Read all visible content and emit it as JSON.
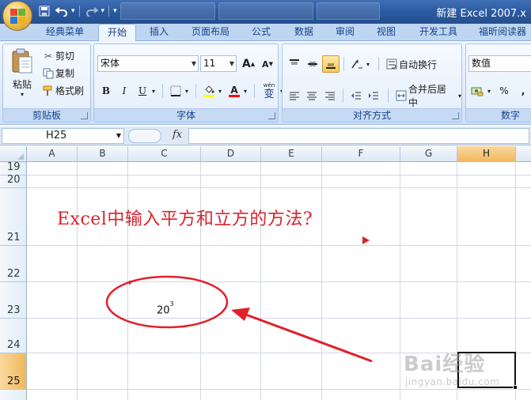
{
  "window": {
    "title": "新建 Excel 2007.x"
  },
  "quick_access": {
    "save_icon": "save-icon",
    "undo_icon": "undo-icon",
    "redo_icon": "redo-icon"
  },
  "ribbon_tabs": [
    "经典菜单",
    "开始",
    "插入",
    "页面布局",
    "公式",
    "数据",
    "审阅",
    "视图",
    "开发工具",
    "福昕阅读器"
  ],
  "active_tab": "开始",
  "clipboard": {
    "label": "剪贴板",
    "paste": "粘贴",
    "cut": "剪切",
    "copy": "复制",
    "format_painter": "格式刷"
  },
  "font": {
    "label": "字体",
    "name": "宋体",
    "size": "11",
    "grow_glyph": "A",
    "shrink_glyph": "A",
    "bold": "B",
    "italic": "I",
    "underline": "U",
    "font_color_glyph": "A",
    "phonetic_glyph": "wén",
    "phonetic_char": "变"
  },
  "alignment": {
    "label": "对齐方式",
    "wrap_text": "自动换行",
    "merge_center": "合并后居中"
  },
  "number": {
    "label": "数字",
    "format": "数值",
    "percent": "%"
  },
  "formula_bar": {
    "name_box": "H25",
    "fx": "fx",
    "formula": ""
  },
  "sheet": {
    "columns": [
      "A",
      "B",
      "C",
      "D",
      "E",
      "F",
      "G",
      "H"
    ],
    "selected_column": "H",
    "rows": [
      "19",
      "20",
      "21",
      "22",
      "23",
      "24",
      "25"
    ],
    "selected_row": "25",
    "heading_text": "Excel中输入平方和立方的方法?",
    "cell_base": "20",
    "cell_exponent": "3",
    "annotation_color": "#e0202a"
  },
  "watermark": {
    "main": "Bai经验",
    "sub": "jingyan.baidu.com"
  }
}
